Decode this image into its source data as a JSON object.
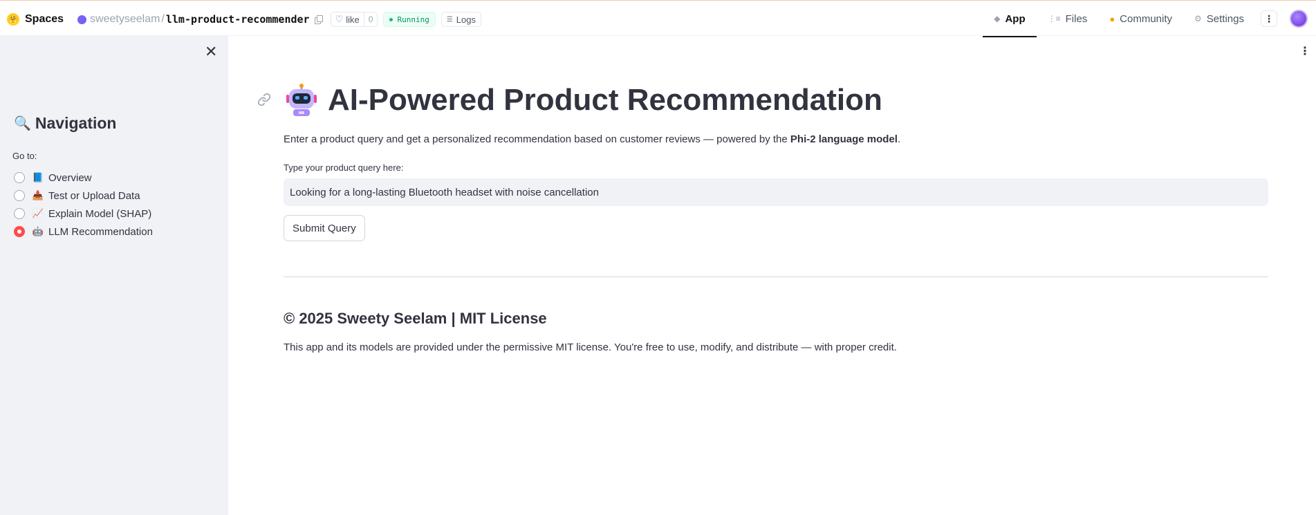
{
  "header": {
    "brand": "Spaces",
    "owner": "sweetyseelam",
    "separator": "/",
    "repo": "llm-product-recommender",
    "like_label": "like",
    "like_count": "0",
    "status": "Running",
    "logs_label": "Logs",
    "tabs": [
      {
        "label": "App",
        "icon": "cube-icon",
        "active": true
      },
      {
        "label": "Files",
        "icon": "files-icon",
        "active": false
      },
      {
        "label": "Community",
        "icon": "community-icon",
        "active": false
      },
      {
        "label": "Settings",
        "icon": "gear-icon",
        "active": false
      }
    ]
  },
  "sidebar": {
    "title": "Navigation",
    "goto_label": "Go to:",
    "options": [
      {
        "emoji": "📘",
        "label": "Overview",
        "selected": false
      },
      {
        "emoji": "📥",
        "label": "Test or Upload Data",
        "selected": false
      },
      {
        "emoji": "📈",
        "label": "Explain Model (SHAP)",
        "selected": false
      },
      {
        "emoji": "🤖",
        "label": "LLM Recommendation",
        "selected": true
      }
    ]
  },
  "main": {
    "title": "AI-Powered Product Recommendation",
    "desc_prefix": "Enter a product query and get a personalized recommendation based on customer reviews — powered by the ",
    "desc_bold": "Phi-2 language model",
    "desc_suffix": ".",
    "input_label": "Type your product query here:",
    "input_value": "Looking for a long-lasting Bluetooth headset with noise cancellation",
    "submit_label": "Submit Query",
    "footer_title": "© 2025 Sweety Seelam | MIT License",
    "footer_text": "This app and its models are provided under the permissive MIT license. You're free to use, modify, and distribute — with proper credit."
  },
  "colors": {
    "accent_radio": "#ff4b4b",
    "sidebar_bg": "#f0f2f6",
    "running_green": "#059669",
    "text": "#31333f"
  }
}
